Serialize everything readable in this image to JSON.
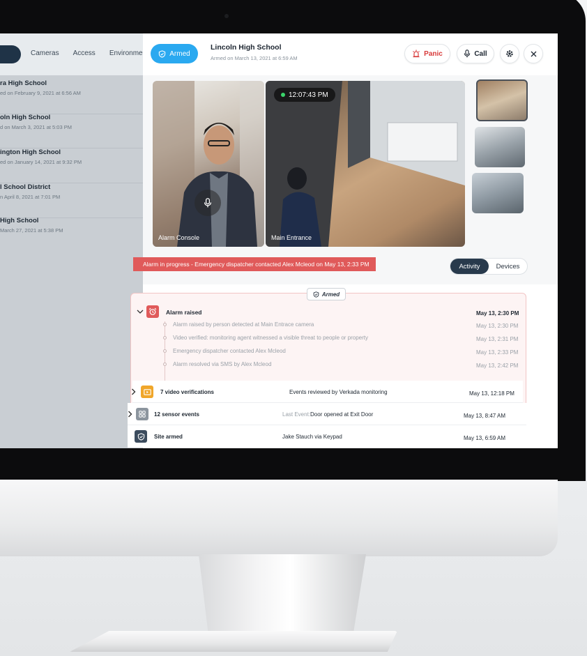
{
  "sidebar": {
    "nav": [
      "Cameras",
      "Access",
      "Environment"
    ],
    "sites": [
      {
        "name": "ra High School",
        "sub": "ed on February 9, 2021 at 6:56 AM"
      },
      {
        "name": "oln High School",
        "sub": "d on March 3, 2021 at 5:03 PM"
      },
      {
        "name": "ington High School",
        "sub": "ed on January 14, 2021 at 9:32 PM"
      },
      {
        "name": "l School District",
        "sub": "n April 8, 2021 at 7:01 PM"
      },
      {
        "name": "High School",
        "sub": "March 27, 2021 at 5:38 PM"
      }
    ]
  },
  "header": {
    "armed_label": "Armed",
    "title": "Lincoln High School",
    "subtitle": "Armed on March 13, 2021 at 6:59 AM",
    "panic_label": "Panic",
    "call_label": "Call"
  },
  "video": {
    "left_label": "Alarm Console",
    "main_label": "Main Entrance",
    "timestamp": "12:07:43 PM"
  },
  "banner": "Alarm in progress - Emergency dispatcher contacted Alex Mcleod on May 13, 2:33 PM",
  "tabs": {
    "activity": "Activity",
    "devices": "Devices"
  },
  "timeline": {
    "armed_chip": "Armed",
    "alarm_title": "Alarm raised",
    "alarm_time": "May 13, 2:30 PM",
    "steps": [
      {
        "text": "Alarm raised by person detected at Main Entrace camera",
        "time": "May 13, 2:30 PM"
      },
      {
        "text": "Video verified: monitoring agent witnessed a visible threat to people or property",
        "time": "May 13, 2:31 PM"
      },
      {
        "text": "Emergency dispatcher contacted Alex Mcleod",
        "time": "May 13, 2:33 PM"
      },
      {
        "text": "Alarm resolved via SMS by Alex Mcleod",
        "time": "May 13, 2:42 PM"
      }
    ]
  },
  "events": [
    {
      "title": "7 video verifications",
      "desc_prefix": "",
      "desc": "Events reviewed by Verkada monitoring",
      "time": "May 13, 12:18 PM"
    },
    {
      "title": "12 sensor events",
      "desc_prefix": "Last Event:",
      "desc": "Door opened at Exit Door",
      "time": "May 13, 8:47 AM"
    },
    {
      "title": "Site armed",
      "desc_prefix": "",
      "desc": "Jake Stauch via Keypad",
      "time": "May 13, 6:59 AM"
    }
  ],
  "colors": {
    "accent": "#2aa9f0",
    "alarm": "#e05a5a",
    "panic": "#d83b3b",
    "dark_tab": "#283a4c"
  }
}
